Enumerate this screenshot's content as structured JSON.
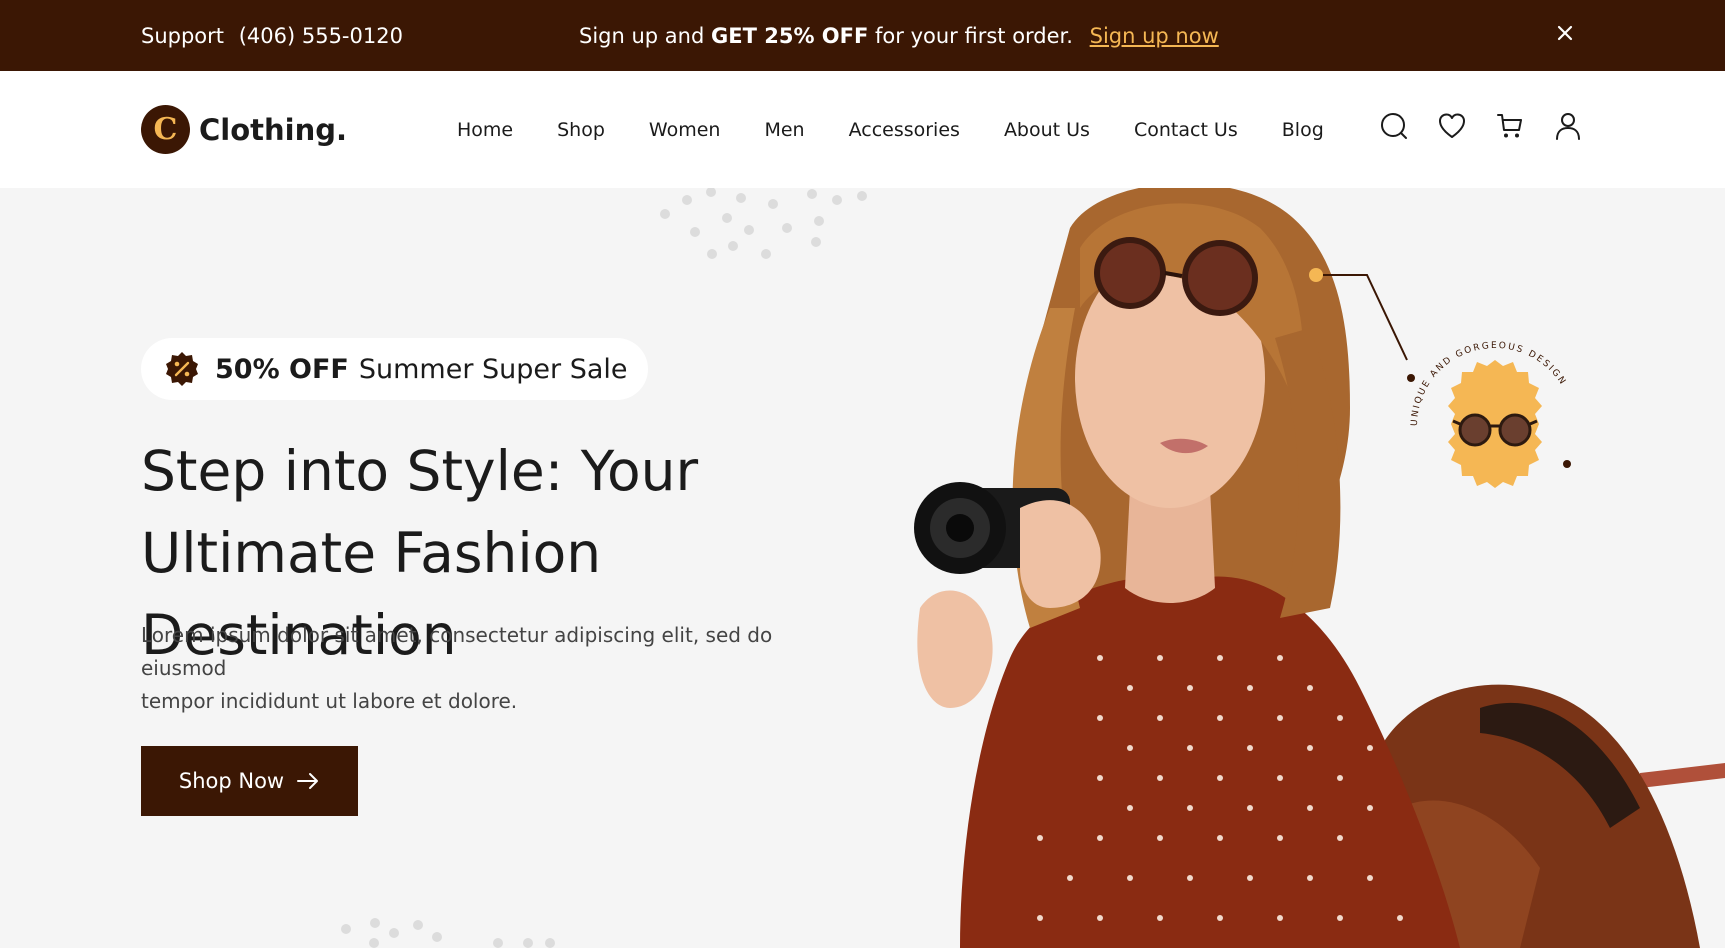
{
  "topbar": {
    "support_label": "Support",
    "support_phone": "(406) 555-0120",
    "promo_prefix": "Sign up and",
    "promo_strong": "GET 25% OFF",
    "promo_suffix": "for your first order.",
    "promo_link": "Sign up now",
    "close_icon": "close-icon"
  },
  "header": {
    "logo_letter": "C",
    "logo_name": "Clothing.",
    "nav": [
      "Home",
      "Shop",
      "Women",
      "Men",
      "Accessories",
      "About Us",
      "Contact Us",
      "Blog"
    ],
    "icons": [
      "search-icon",
      "heart-icon",
      "cart-icon",
      "user-icon"
    ]
  },
  "hero": {
    "badge_strong": "50% OFF",
    "badge_text": "Summer Super Sale",
    "headline_line1": "Step into Style: Your",
    "headline_line2": "Ultimate Fashion Destination",
    "description_line1": "Lorem ipsum dolor sit amet, consectetur adipiscing elit, sed do eiusmod",
    "description_line2": "tempor incididunt ut labore et dolore.",
    "button_label": "Shop Now",
    "callout_text": "UNIQUE AND GORGEOUS DESIGN"
  },
  "colors": {
    "brand_brown": "#3b1704",
    "accent_yellow": "#f5b754",
    "hero_bg": "#f5f5f5"
  }
}
